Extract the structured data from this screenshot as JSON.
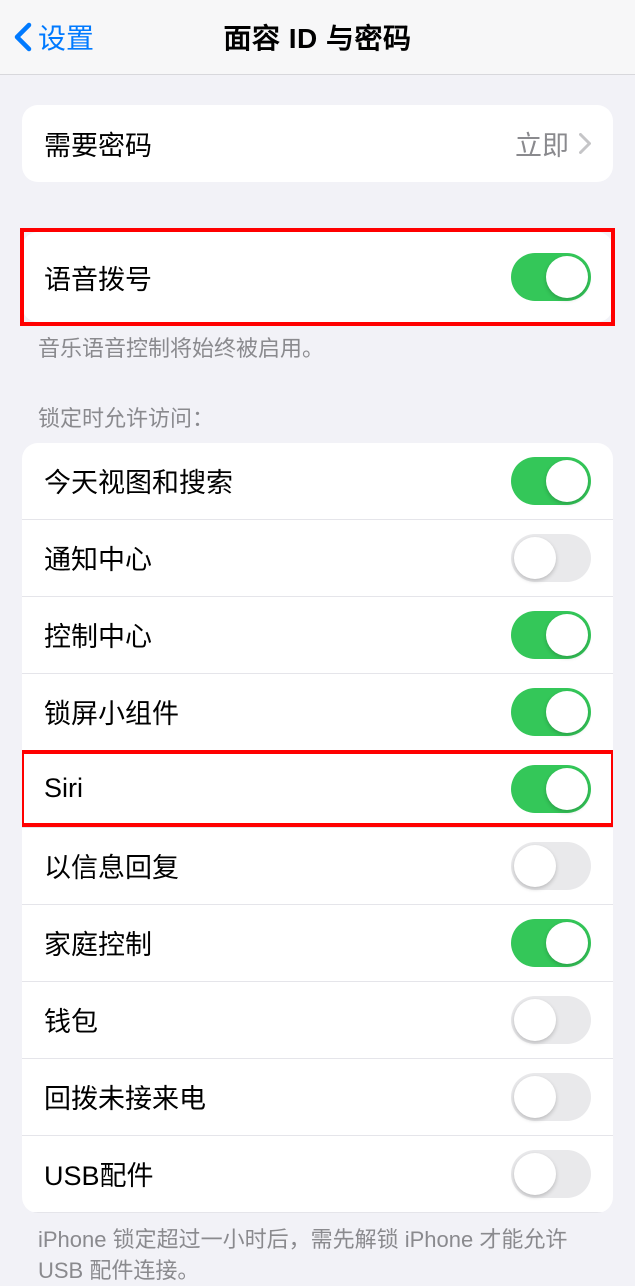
{
  "header": {
    "back_label": "设置",
    "title": "面容 ID 与密码"
  },
  "require_passcode": {
    "label": "需要密码",
    "value": "立即"
  },
  "voice_dial": {
    "label": "语音拨号",
    "enabled": true,
    "footer": "音乐语音控制将始终被启用。"
  },
  "lockscreen_section": {
    "header": "锁定时允许访问：",
    "items": [
      {
        "label": "今天视图和搜索",
        "enabled": true
      },
      {
        "label": "通知中心",
        "enabled": false
      },
      {
        "label": "控制中心",
        "enabled": true
      },
      {
        "label": "锁屏小组件",
        "enabled": true
      },
      {
        "label": "Siri",
        "enabled": true
      },
      {
        "label": "以信息回复",
        "enabled": false
      },
      {
        "label": "家庭控制",
        "enabled": true
      },
      {
        "label": "钱包",
        "enabled": false
      },
      {
        "label": "回拨未接来电",
        "enabled": false
      },
      {
        "label": "USB配件",
        "enabled": false
      }
    ],
    "footer": "iPhone 锁定超过一小时后，需先解锁 iPhone 才能允许 USB 配件连接。"
  }
}
